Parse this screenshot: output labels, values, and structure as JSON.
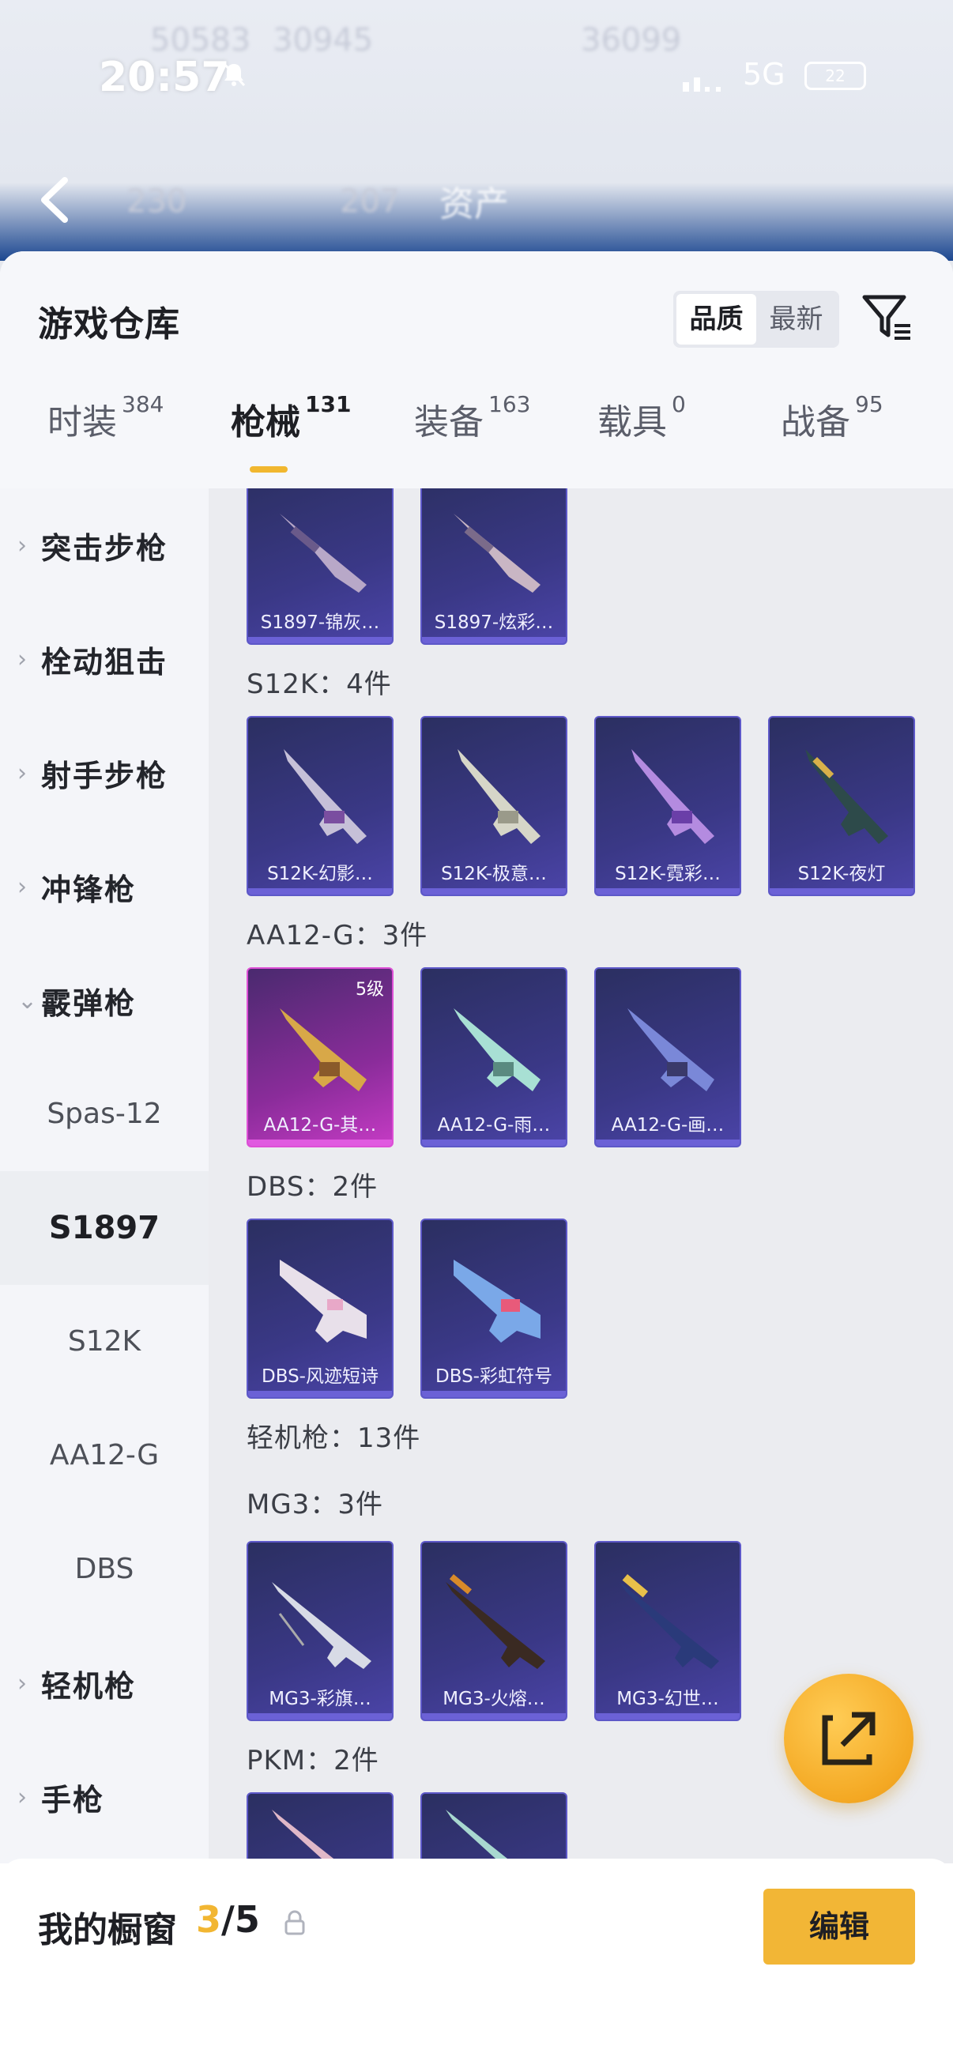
{
  "status_bar": {
    "time": "20:57",
    "network": "5G",
    "battery": "22"
  },
  "background": {
    "title": "资产",
    "blur_numbers": [
      "50583",
      "30945",
      "36099",
      "230",
      "207"
    ]
  },
  "sheet": {
    "title": "游戏仓库",
    "sort": {
      "quality": "品质",
      "newest": "最新",
      "selected": "品质"
    },
    "tabs": [
      {
        "label": "时装",
        "count": "384"
      },
      {
        "label": "枪械",
        "count": "131",
        "active": true
      },
      {
        "label": "装备",
        "count": "163"
      },
      {
        "label": "载具",
        "count": "0"
      },
      {
        "label": "战备",
        "count": "95"
      }
    ]
  },
  "sidebar": {
    "categories": [
      {
        "label": "突击步枪",
        "chevron": "›"
      },
      {
        "label": "栓动狙击",
        "chevron": "›"
      },
      {
        "label": "射手步枪",
        "chevron": "›"
      },
      {
        "label": "冲锋枪",
        "chevron": "›"
      },
      {
        "label": "霰弹枪",
        "chevron": "⌄"
      }
    ],
    "subitems": [
      "Spas-12",
      "S1897",
      "S12K",
      "AA12-G",
      "DBS"
    ],
    "active_subitem": "S1897",
    "more_categories": [
      {
        "label": "轻机枪",
        "chevron": "›"
      },
      {
        "label": "手枪",
        "chevron": "›"
      }
    ]
  },
  "content": {
    "s1897_cards": [
      "S1897-锦灰…",
      "S1897-炫彩…"
    ],
    "s12k": {
      "label": "S12K：4件",
      "cards": [
        "S12K-幻影…",
        "S12K-极意…",
        "S12K-霓彩…",
        "S12K-夜灯"
      ]
    },
    "aa12g": {
      "label": "AA12-G：3件",
      "cards": [
        "AA12-G-其…",
        "AA12-G-雨…",
        "AA12-G-画…"
      ],
      "level_badge": "5级"
    },
    "dbs": {
      "label": "DBS：2件",
      "cards": [
        "DBS-风迹短诗",
        "DBS-彩虹符号"
      ]
    },
    "lmg_label": "轻机枪：13件",
    "mg3": {
      "label": "MG3：3件",
      "cards": [
        "MG3-彩旗…",
        "MG3-火熔…",
        "MG3-幻世…"
      ]
    },
    "pkm": {
      "label": "PKM：2件"
    }
  },
  "bottom_bar": {
    "title": "我的橱窗",
    "count_current": "3",
    "count_total": "/5",
    "edit_label": "编辑"
  },
  "colors": {
    "accent": "#f2b636",
    "card_purple": "#3a3886",
    "card_gold": "#c53bc4"
  }
}
